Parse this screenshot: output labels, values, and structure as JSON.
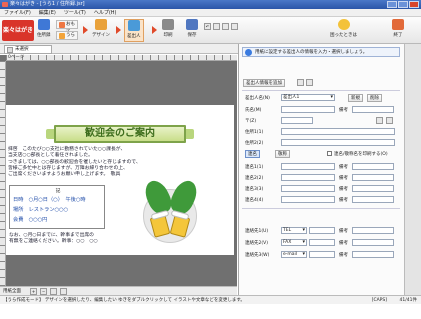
{
  "window": {
    "title": "楽々はがき - [うら1 / 住所録.jsr]"
  },
  "menu": [
    "ファイル(F)",
    "編集(E)",
    "ツール(T)",
    "ヘルプ(H)"
  ],
  "toolbar": {
    "logo": "楽々はがき",
    "address_book": "住所録",
    "omote": "おもて",
    "ura": "うら",
    "design": "デザイン",
    "sender": "差出人",
    "print": "印刷",
    "save": "保存",
    "help": "困ったときは",
    "exit": "終了"
  },
  "doc_tab": {
    "label": "未選択"
  },
  "page_label": "0ページ",
  "postcard": {
    "banner": "歓迎会のご案内",
    "greeting": "拝啓　このたび○○支社に勤務されていた○○課長が、\n当支店○○部長として着任されました。\nつきましては、○○部長の歓迎会を催したいと存じますので、\n皆様ご多忙中とは存じますが、万障お繰り合わせの上、\nご出席くださいますようお願い申し上げます。　敬具",
    "detail_title": "記",
    "rows": [
      "日時　○月○日（○）　午後○時",
      "場所　レストラン○○○",
      "会費　○○○円"
    ],
    "footer": "なお、○月○日までに、幹事まで出席の\n有無をご連絡ください。幹事：○○　○○"
  },
  "status": {
    "zoom_label": "用紙全面",
    "message": "【うら作成モード】 デザインを選択したり、編集したい ゆきをダブルクリックして イラストや文章などを変更します。",
    "caps": "[CAPS]",
    "page_count": "41/41件"
  },
  "panel": {
    "hint": "用紙に設定する差出人の情報を入力・選択しましょう。",
    "add_sender": "差出人情報を追加",
    "sender_name_label": "差出人名(N)",
    "sender_name_value": "差出人1",
    "new_label": "新規",
    "delete_label": "削除",
    "name_label": "氏名(M)",
    "remarks_label": "備考",
    "postal_label": "〒(Z)",
    "address1_label": "住所1(1)",
    "address2_label": "住所2(2)",
    "joint_tab": "連名",
    "add_title_button": "敬称",
    "joint_checkbox": "連名/敬称名を印刷する(O)",
    "joint_rows": [
      {
        "label": "連名1(1)",
        "remark": "備考"
      },
      {
        "label": "連名2(2)",
        "remark": "備考"
      },
      {
        "label": "連名3(3)",
        "remark": "備考"
      },
      {
        "label": "連名4(4)",
        "remark": "備考"
      }
    ],
    "contact_rows": [
      {
        "label": "連絡先1(U)",
        "type": "TEL",
        "remark": "備考"
      },
      {
        "label": "連絡先2(V)",
        "type": "FAX",
        "remark": "備考"
      },
      {
        "label": "連絡先3(W)",
        "type": "e-mail",
        "remark": "備考"
      }
    ]
  }
}
